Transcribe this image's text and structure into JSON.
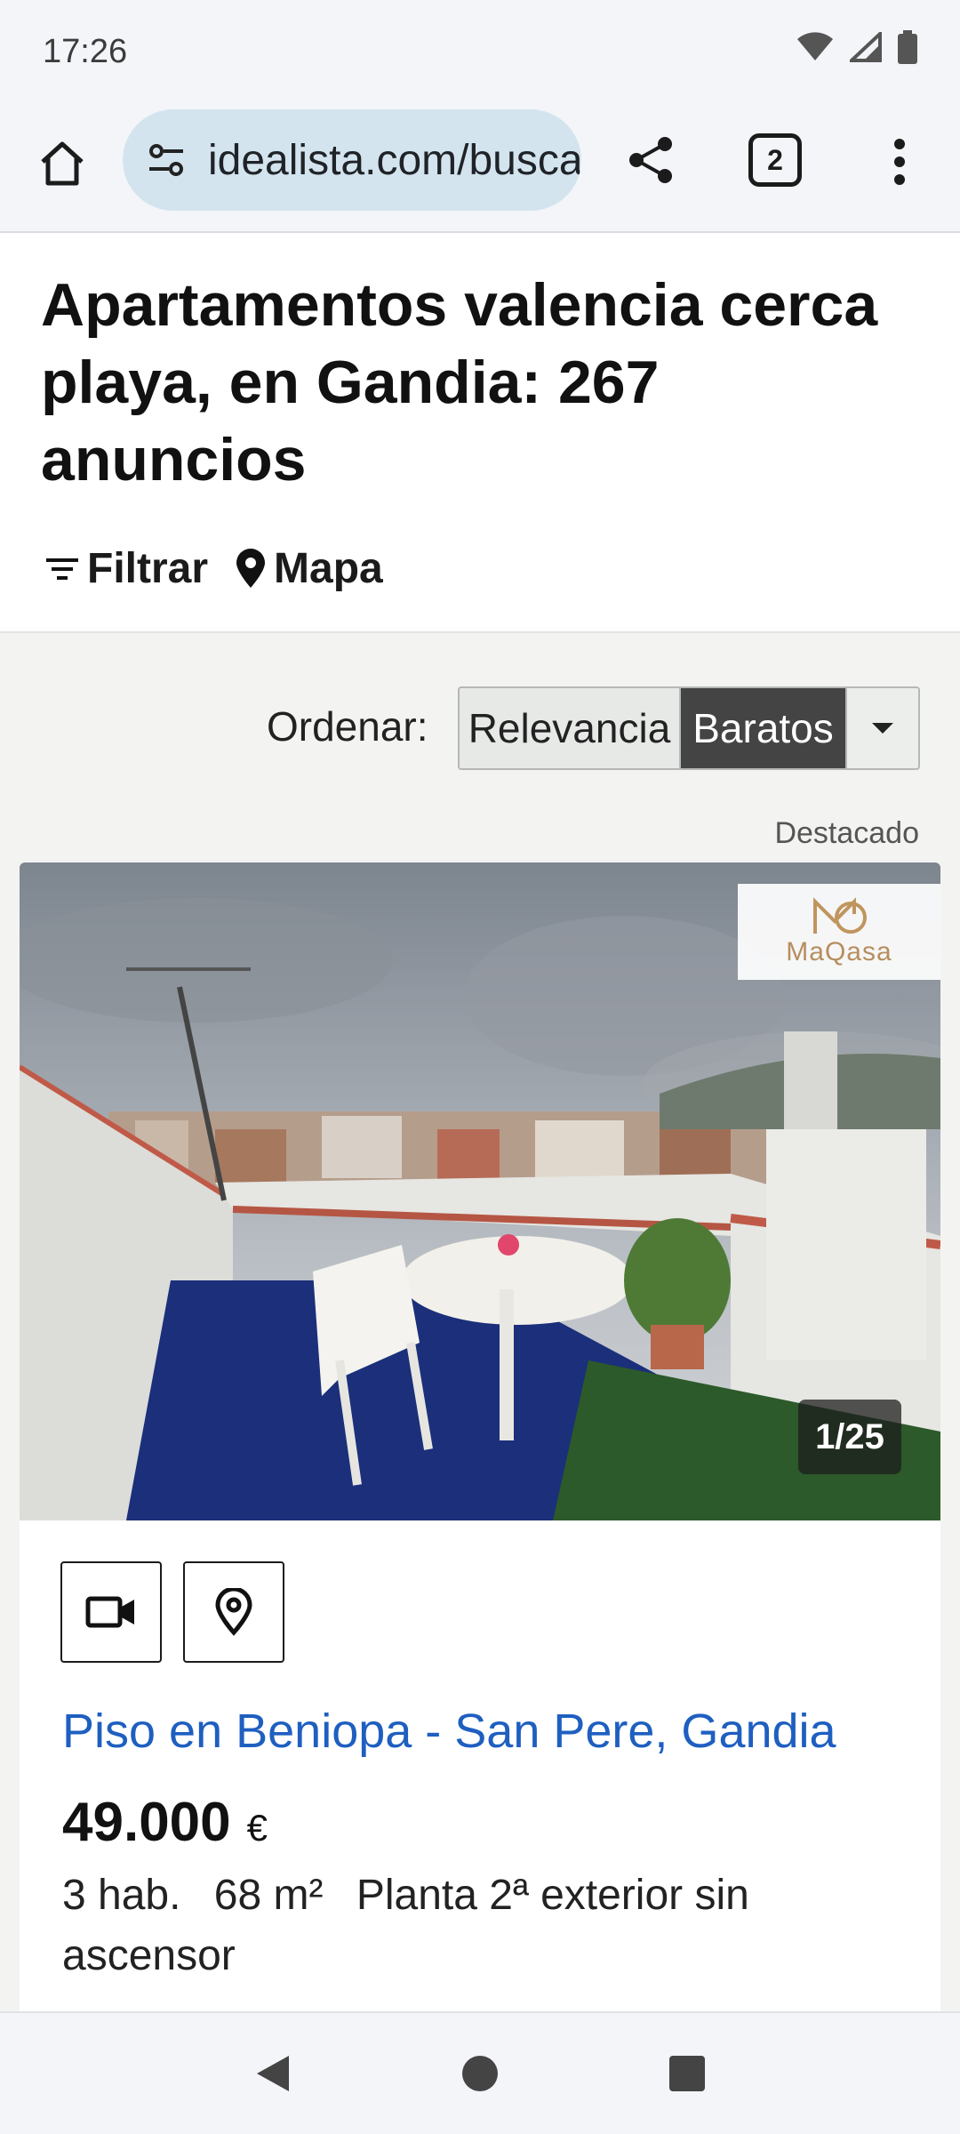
{
  "status_bar": {
    "time": "17:26",
    "icons": [
      "wifi-icon",
      "signal-icon",
      "battery-icon"
    ]
  },
  "browser": {
    "url": "idealista.com/buscar",
    "tab_count": "2"
  },
  "header": {
    "title": "Apartamentos valencia cerca playa, en Gandia: 267 anuncios",
    "filter_label": "Filtrar",
    "map_label": "Mapa"
  },
  "sort": {
    "label": "Ordenar:",
    "options": [
      "Relevancia",
      "Baratos"
    ],
    "selected": "Baratos"
  },
  "listing": {
    "badge": "Destacado",
    "agency_logo": "MaQasa",
    "photo_counter": "1/25",
    "title": "Piso en Beniopa - San Pere, Gandia",
    "price": "49.000",
    "currency": "€",
    "rooms": "3 hab.",
    "size": "68 m²",
    "floor": "Planta 2ª exterior sin ascensor"
  },
  "colors": {
    "link": "#1e5fc0",
    "selected_sort_bg": "#444444",
    "url_pill": "#d4e4ee"
  }
}
